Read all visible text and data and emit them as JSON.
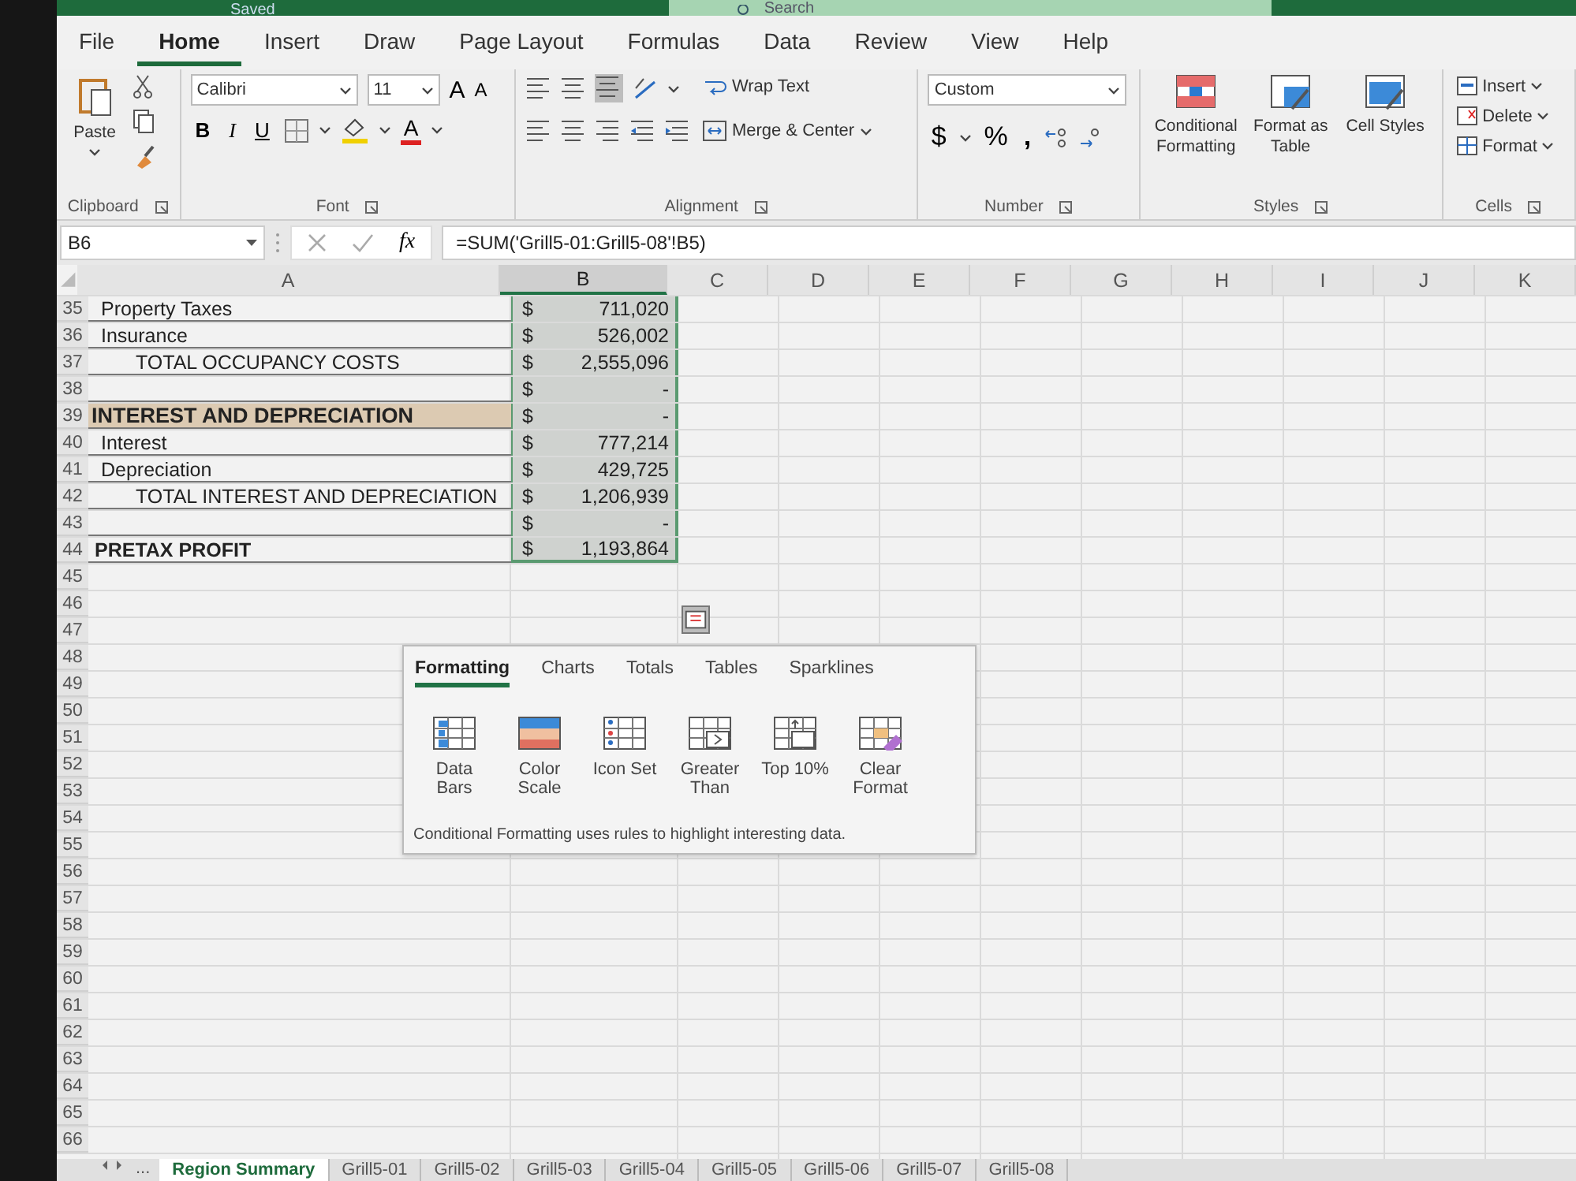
{
  "title_bar": {
    "status": "Saved",
    "search": {
      "placeholder": "Search"
    }
  },
  "menu_tabs": [
    {
      "label": "File",
      "selected": false
    },
    {
      "label": "Home",
      "selected": true
    },
    {
      "label": "Insert",
      "selected": false
    },
    {
      "label": "Draw",
      "selected": false
    },
    {
      "label": "Page Layout",
      "selected": false
    },
    {
      "label": "Formulas",
      "selected": false
    },
    {
      "label": "Data",
      "selected": false
    },
    {
      "label": "Review",
      "selected": false
    },
    {
      "label": "View",
      "selected": false
    },
    {
      "label": "Help",
      "selected": false
    }
  ],
  "ribbon": {
    "clipboard": {
      "label": "Clipboard",
      "paste": "Paste"
    },
    "font": {
      "label": "Font",
      "name": "Calibri",
      "size": "11",
      "grow": "A",
      "shrink": "A",
      "styles": [
        {
          "label": "B",
          "kind": "bold"
        },
        {
          "label": "I",
          "kind": "italic"
        },
        {
          "label": "U",
          "kind": "underline"
        }
      ],
      "font_color": "A"
    },
    "alignment": {
      "label": "Alignment",
      "wrap_text": "Wrap Text",
      "merge": "Merge & Center"
    },
    "number": {
      "label": "Number",
      "format": "Custom",
      "symbols": [
        "$",
        "%",
        ","
      ]
    },
    "styles": {
      "label": "Styles",
      "buttons": [
        {
          "label": "Conditional Formatting",
          "kind": "conditional"
        },
        {
          "label": "Format as Table",
          "kind": "table"
        },
        {
          "label": "Cell Styles",
          "kind": "cell"
        }
      ]
    },
    "cells": {
      "label": "Cells",
      "buttons": [
        {
          "label": "Insert",
          "kind": "insert"
        },
        {
          "label": "Delete",
          "kind": "delete"
        },
        {
          "label": "Format",
          "kind": "format"
        }
      ]
    }
  },
  "formula_bar": {
    "name_box": "B6",
    "fx": "fx",
    "formula": "=SUM('Grill5-01:Grill5-08'!B5)"
  },
  "sheet": {
    "columns": [
      {
        "label": "A",
        "selected": false
      },
      {
        "label": "B",
        "selected": true
      },
      {
        "label": "C",
        "selected": false
      },
      {
        "label": "D",
        "selected": false
      },
      {
        "label": "E",
        "selected": false
      },
      {
        "label": "F",
        "selected": false
      },
      {
        "label": "G",
        "selected": false
      },
      {
        "label": "H",
        "selected": false
      },
      {
        "label": "I",
        "selected": false
      },
      {
        "label": "J",
        "selected": false
      },
      {
        "label": "K",
        "selected": false
      }
    ],
    "rows": [
      {
        "number": "35",
        "kind": "item",
        "label": "Property Taxes",
        "currency": "$",
        "value": "711,020"
      },
      {
        "number": "36",
        "kind": "item",
        "label": "Insurance",
        "currency": "$",
        "value": "526,002"
      },
      {
        "number": "37",
        "kind": "total",
        "label": "TOTAL OCCUPANCY COSTS",
        "currency": "$",
        "value": "2,555,096"
      },
      {
        "number": "38",
        "kind": "blank",
        "currency": "$",
        "value": "-"
      },
      {
        "number": "39",
        "kind": "section",
        "label": "INTEREST AND DEPRECIATION",
        "currency": "$",
        "value": "-"
      },
      {
        "number": "40",
        "kind": "item",
        "label": "Interest",
        "currency": "$",
        "value": "777,214"
      },
      {
        "number": "41",
        "kind": "item",
        "label": "Depreciation",
        "currency": "$",
        "value": "429,725"
      },
      {
        "number": "42",
        "kind": "total",
        "label": "TOTAL INTEREST AND DEPRECIATION",
        "currency": "$",
        "value": "1,206,939"
      },
      {
        "number": "43",
        "kind": "blank",
        "currency": "$",
        "value": "-"
      },
      {
        "number": "44",
        "kind": "profit",
        "label": "PRETAX PROFIT",
        "currency": "$",
        "value": "1,193,864"
      }
    ],
    "empty_rows": [
      "45",
      "46",
      "47",
      "48",
      "49",
      "50",
      "51",
      "52",
      "53",
      "54",
      "55",
      "56",
      "57",
      "58",
      "59",
      "60",
      "61",
      "62",
      "63",
      "64",
      "65",
      "66"
    ]
  },
  "quick_analysis": {
    "tabs": [
      {
        "label": "Formatting",
        "selected": true
      },
      {
        "label": "Charts",
        "selected": false
      },
      {
        "label": "Totals",
        "selected": false
      },
      {
        "label": "Tables",
        "selected": false
      },
      {
        "label": "Sparklines",
        "selected": false
      }
    ],
    "items": [
      {
        "label": "Data Bars",
        "kind": "data_bars"
      },
      {
        "label": "Color Scale",
        "kind": "color_scale"
      },
      {
        "label": "Icon Set",
        "kind": "icon_set"
      },
      {
        "label": "Greater Than",
        "kind": "greater_than"
      },
      {
        "label": "Top 10%",
        "kind": "top_ten"
      },
      {
        "label": "Clear Format",
        "kind": "clear"
      }
    ],
    "description": "Conditional Formatting uses rules to highlight interesting data."
  },
  "sheet_tabs": {
    "more": "...",
    "tabs": [
      {
        "label": "Region Summary",
        "selected": true
      },
      {
        "label": "Grill5-01",
        "selected": false
      },
      {
        "label": "Grill5-02",
        "selected": false
      },
      {
        "label": "Grill5-03",
        "selected": false
      },
      {
        "label": "Grill5-04",
        "selected": false
      },
      {
        "label": "Grill5-05",
        "selected": false
      },
      {
        "label": "Grill5-06",
        "selected": false
      },
      {
        "label": "Grill5-07",
        "selected": false
      },
      {
        "label": "Grill5-08",
        "selected": false
      }
    ]
  }
}
